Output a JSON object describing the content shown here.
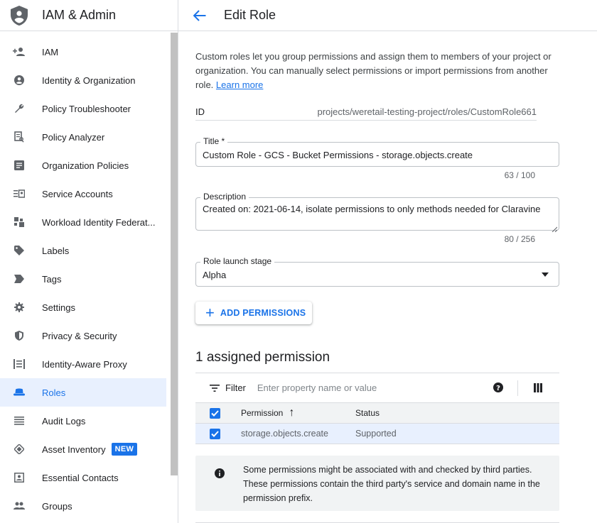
{
  "sidebar": {
    "title": "IAM & Admin",
    "items": [
      {
        "label": "IAM",
        "icon": "person-add-icon"
      },
      {
        "label": "Identity & Organization",
        "icon": "account-circle-icon"
      },
      {
        "label": "Policy Troubleshooter",
        "icon": "wrench-icon"
      },
      {
        "label": "Policy Analyzer",
        "icon": "document-search-icon"
      },
      {
        "label": "Organization Policies",
        "icon": "list-doc-icon"
      },
      {
        "label": "Service Accounts",
        "icon": "service-account-icon"
      },
      {
        "label": "Workload Identity Federat...",
        "icon": "workload-identity-icon"
      },
      {
        "label": "Labels",
        "icon": "label-icon"
      },
      {
        "label": "Tags",
        "icon": "tag-icon"
      },
      {
        "label": "Settings",
        "icon": "gear-icon"
      },
      {
        "label": "Privacy & Security",
        "icon": "shield-icon"
      },
      {
        "label": "Identity-Aware Proxy",
        "icon": "proxy-icon"
      },
      {
        "label": "Roles",
        "icon": "roles-icon",
        "active": true
      },
      {
        "label": "Audit Logs",
        "icon": "list-icon"
      },
      {
        "label": "Asset Inventory",
        "icon": "asset-icon",
        "badge": "NEW"
      },
      {
        "label": "Essential Contacts",
        "icon": "contacts-icon"
      },
      {
        "label": "Groups",
        "icon": "groups-icon"
      }
    ]
  },
  "header": {
    "title": "Edit Role"
  },
  "intro": {
    "text": "Custom roles let you group permissions and assign them to members of your project or organization. You can manually select permissions or import permissions from another role.",
    "link": "Learn more"
  },
  "id_row": {
    "label": "ID",
    "value": "projects/weretail-testing-project/roles/CustomRole661"
  },
  "title_field": {
    "label": "Title *",
    "value": "Custom Role - GCS - Bucket Permissions - storage.objects.create",
    "counter": "63 / 100"
  },
  "description_field": {
    "label": "Description",
    "value": "Created on: 2021-06-14, isolate permissions to only methods needed for Claravine",
    "counter": "80 / 256"
  },
  "stage_field": {
    "label": "Role launch stage",
    "value": "Alpha"
  },
  "add_button": {
    "label": "ADD PERMISSIONS"
  },
  "permissions": {
    "title": "1 assigned permission",
    "filter_label": "Filter",
    "filter_placeholder": "Enter property name or value",
    "columns": {
      "permission": "Permission",
      "status": "Status"
    },
    "rows": [
      {
        "permission": "storage.objects.create",
        "status": "Supported"
      }
    ]
  },
  "info": {
    "text": "Some permissions might be associated with and checked by third parties. These permissions contain the third party's service and domain name in the permission prefix."
  },
  "colors": {
    "accent": "#1a73e8",
    "active_bg": "#e8f0fe"
  }
}
